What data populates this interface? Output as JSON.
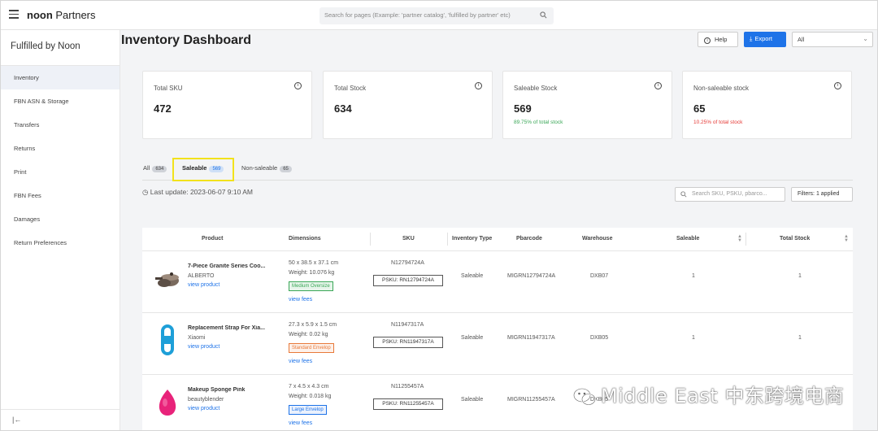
{
  "topbar": {
    "brand_bold": "noon",
    "brand_rest": " Partners",
    "search_placeholder": "Search for pages (Example: 'partner catalog', 'fulfilled by partner' etc)"
  },
  "sidebar": {
    "title": "Fulfilled by Noon",
    "items": [
      {
        "label": "Inventory",
        "active": true
      },
      {
        "label": "FBN ASN & Storage"
      },
      {
        "label": "Transfers"
      },
      {
        "label": "Returns"
      },
      {
        "label": "Print"
      },
      {
        "label": "FBN Fees"
      },
      {
        "label": "Damages"
      },
      {
        "label": "Return Preferences"
      }
    ],
    "collapse_glyph": "|←"
  },
  "main": {
    "title": "Inventory Dashboard",
    "help_label": "Help",
    "export_label": "Export",
    "select_value": "All",
    "cards": [
      {
        "label": "Total SKU",
        "value": "472",
        "sub": ""
      },
      {
        "label": "Total Stock",
        "value": "634",
        "sub": ""
      },
      {
        "label": "Saleable Stock",
        "value": "569",
        "sub": "89.75% of total stock",
        "sub_color": "#3aa757"
      },
      {
        "label": "Non-saleable stock",
        "value": "65",
        "sub": "10.25% of total stock",
        "sub_color": "#e53935"
      }
    ],
    "tabs": [
      {
        "label": "All",
        "count": "634"
      },
      {
        "label": "Saleable",
        "count": "569",
        "selected": true
      },
      {
        "label": "Non-saleable",
        "count": "65"
      }
    ],
    "last_update": "Last update: 2023-06-07 9:10 AM",
    "filter_search_placeholder": "Search SKU, PSKU, pbarco...",
    "filters_label": "Filters:",
    "filters_applied": "1 applied",
    "table": {
      "headers": [
        "Product",
        "Dimensions",
        "SKU",
        "Inventory Type",
        "Pbarcode",
        "Warehouse",
        "Saleable",
        "Total Stock"
      ],
      "rows": [
        {
          "name": "7-Piece Granite Series Coo...",
          "brand": "ALBERTO",
          "link": "view product",
          "size": "50 x 38.5 x 37.1 cm",
          "weight": "Weight: 10.076 kg",
          "tag": "Medium Oversize",
          "tag_color": "#3aa757",
          "fees": "view fees",
          "sku": "N12794724A",
          "psku": "PSKU: RN12794724A",
          "inv_type": "Saleable",
          "pbarcode": "MIGRN12794724A",
          "warehouse": "DXB07",
          "saleable": "1",
          "total": "1",
          "image": "cookware"
        },
        {
          "name": "Replacement Strap For Xia...",
          "brand": "Xiaomi",
          "link": "view product",
          "size": "27.3 x 5.9 x 1.5 cm",
          "weight": "Weight: 0.02 kg",
          "tag": "Standard Envelop",
          "tag_color": "#e8793a",
          "fees": "view fees",
          "sku": "N11947317A",
          "psku": "PSKU: RN11947317A",
          "inv_type": "Saleable",
          "pbarcode": "MIGRN11947317A",
          "warehouse": "DXB05",
          "saleable": "1",
          "total": "1",
          "image": "strap"
        },
        {
          "name": "Makeup Sponge Pink",
          "brand": "beautyblender",
          "link": "view product",
          "size": "7 x 4.5 x 4.3 cm",
          "weight": "Weight: 0.018 kg",
          "tag": "Large Envelop",
          "tag_color": "#1e73e8",
          "fees": "view fees",
          "sku": "N11255457A",
          "psku": "PSKU: RN11255457A",
          "inv_type": "Saleable",
          "pbarcode": "MIGRN11255457A",
          "warehouse": "DXB05",
          "saleable": "",
          "total": "",
          "image": "sponge"
        }
      ]
    }
  },
  "watermark": "Middle East 中东跨境电商",
  "colors": {
    "accent": "#1e73e8",
    "highlight": "#f2e21c",
    "positive": "#3aa757",
    "negative": "#e53935"
  }
}
